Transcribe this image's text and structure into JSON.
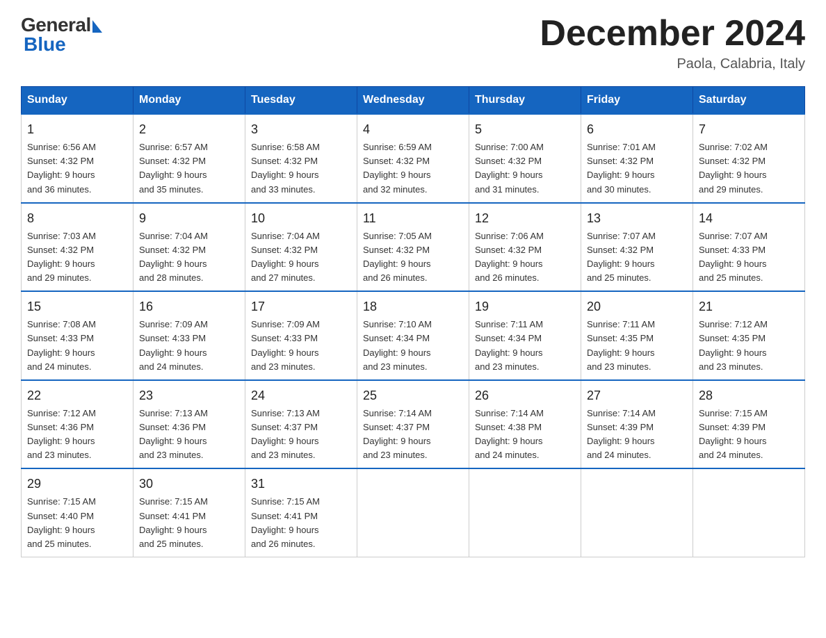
{
  "header": {
    "logo_general": "General",
    "logo_blue": "Blue",
    "title": "December 2024",
    "location": "Paola, Calabria, Italy"
  },
  "days_of_week": [
    "Sunday",
    "Monday",
    "Tuesday",
    "Wednesday",
    "Thursday",
    "Friday",
    "Saturday"
  ],
  "weeks": [
    [
      {
        "day": "1",
        "sunrise": "6:56 AM",
        "sunset": "4:32 PM",
        "daylight": "9 hours and 36 minutes."
      },
      {
        "day": "2",
        "sunrise": "6:57 AM",
        "sunset": "4:32 PM",
        "daylight": "9 hours and 35 minutes."
      },
      {
        "day": "3",
        "sunrise": "6:58 AM",
        "sunset": "4:32 PM",
        "daylight": "9 hours and 33 minutes."
      },
      {
        "day": "4",
        "sunrise": "6:59 AM",
        "sunset": "4:32 PM",
        "daylight": "9 hours and 32 minutes."
      },
      {
        "day": "5",
        "sunrise": "7:00 AM",
        "sunset": "4:32 PM",
        "daylight": "9 hours and 31 minutes."
      },
      {
        "day": "6",
        "sunrise": "7:01 AM",
        "sunset": "4:32 PM",
        "daylight": "9 hours and 30 minutes."
      },
      {
        "day": "7",
        "sunrise": "7:02 AM",
        "sunset": "4:32 PM",
        "daylight": "9 hours and 29 minutes."
      }
    ],
    [
      {
        "day": "8",
        "sunrise": "7:03 AM",
        "sunset": "4:32 PM",
        "daylight": "9 hours and 29 minutes."
      },
      {
        "day": "9",
        "sunrise": "7:04 AM",
        "sunset": "4:32 PM",
        "daylight": "9 hours and 28 minutes."
      },
      {
        "day": "10",
        "sunrise": "7:04 AM",
        "sunset": "4:32 PM",
        "daylight": "9 hours and 27 minutes."
      },
      {
        "day": "11",
        "sunrise": "7:05 AM",
        "sunset": "4:32 PM",
        "daylight": "9 hours and 26 minutes."
      },
      {
        "day": "12",
        "sunrise": "7:06 AM",
        "sunset": "4:32 PM",
        "daylight": "9 hours and 26 minutes."
      },
      {
        "day": "13",
        "sunrise": "7:07 AM",
        "sunset": "4:32 PM",
        "daylight": "9 hours and 25 minutes."
      },
      {
        "day": "14",
        "sunrise": "7:07 AM",
        "sunset": "4:33 PM",
        "daylight": "9 hours and 25 minutes."
      }
    ],
    [
      {
        "day": "15",
        "sunrise": "7:08 AM",
        "sunset": "4:33 PM",
        "daylight": "9 hours and 24 minutes."
      },
      {
        "day": "16",
        "sunrise": "7:09 AM",
        "sunset": "4:33 PM",
        "daylight": "9 hours and 24 minutes."
      },
      {
        "day": "17",
        "sunrise": "7:09 AM",
        "sunset": "4:33 PM",
        "daylight": "9 hours and 23 minutes."
      },
      {
        "day": "18",
        "sunrise": "7:10 AM",
        "sunset": "4:34 PM",
        "daylight": "9 hours and 23 minutes."
      },
      {
        "day": "19",
        "sunrise": "7:11 AM",
        "sunset": "4:34 PM",
        "daylight": "9 hours and 23 minutes."
      },
      {
        "day": "20",
        "sunrise": "7:11 AM",
        "sunset": "4:35 PM",
        "daylight": "9 hours and 23 minutes."
      },
      {
        "day": "21",
        "sunrise": "7:12 AM",
        "sunset": "4:35 PM",
        "daylight": "9 hours and 23 minutes."
      }
    ],
    [
      {
        "day": "22",
        "sunrise": "7:12 AM",
        "sunset": "4:36 PM",
        "daylight": "9 hours and 23 minutes."
      },
      {
        "day": "23",
        "sunrise": "7:13 AM",
        "sunset": "4:36 PM",
        "daylight": "9 hours and 23 minutes."
      },
      {
        "day": "24",
        "sunrise": "7:13 AM",
        "sunset": "4:37 PM",
        "daylight": "9 hours and 23 minutes."
      },
      {
        "day": "25",
        "sunrise": "7:14 AM",
        "sunset": "4:37 PM",
        "daylight": "9 hours and 23 minutes."
      },
      {
        "day": "26",
        "sunrise": "7:14 AM",
        "sunset": "4:38 PM",
        "daylight": "9 hours and 24 minutes."
      },
      {
        "day": "27",
        "sunrise": "7:14 AM",
        "sunset": "4:39 PM",
        "daylight": "9 hours and 24 minutes."
      },
      {
        "day": "28",
        "sunrise": "7:15 AM",
        "sunset": "4:39 PM",
        "daylight": "9 hours and 24 minutes."
      }
    ],
    [
      {
        "day": "29",
        "sunrise": "7:15 AM",
        "sunset": "4:40 PM",
        "daylight": "9 hours and 25 minutes."
      },
      {
        "day": "30",
        "sunrise": "7:15 AM",
        "sunset": "4:41 PM",
        "daylight": "9 hours and 25 minutes."
      },
      {
        "day": "31",
        "sunrise": "7:15 AM",
        "sunset": "4:41 PM",
        "daylight": "9 hours and 26 minutes."
      },
      null,
      null,
      null,
      null
    ]
  ],
  "labels": {
    "sunrise": "Sunrise:",
    "sunset": "Sunset:",
    "daylight": "Daylight:"
  }
}
